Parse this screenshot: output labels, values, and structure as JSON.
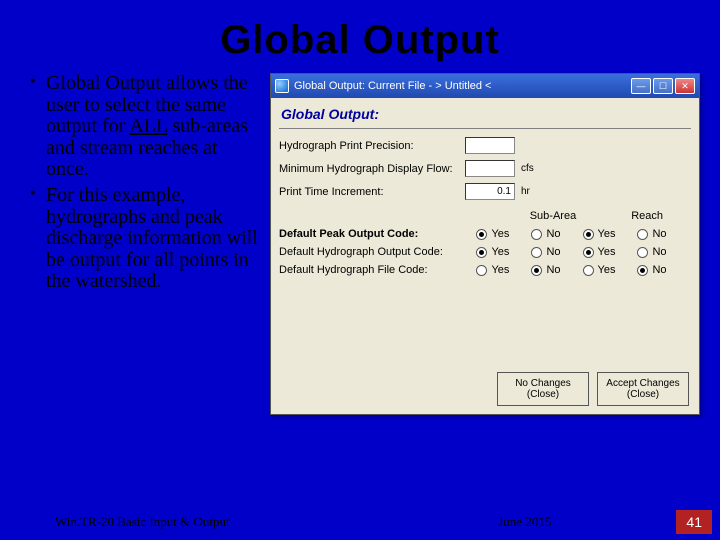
{
  "slide_title": "Global Output",
  "bullets": {
    "b1_pre": "Global Output allows the user to select the same output for ",
    "b1_all": "ALL",
    "b1_post": " sub-areas and stream reaches at once.",
    "b2": "For this example, hydrographs and peak discharge information will be output for all points in the watershed."
  },
  "window": {
    "title": "Global Output: Current File - > Untitled <",
    "section": "Global Output:",
    "rows": {
      "precision_label": "Hydrograph Print Precision:",
      "precision_value": "",
      "minflow_label": "Minimum Hydrograph Display Flow:",
      "minflow_value": "",
      "minflow_unit": "cfs",
      "time_label": "Print Time Increment:",
      "time_value": "0.1",
      "time_unit": "hr"
    },
    "col_sub": "Sub-Area",
    "col_reach": "Reach",
    "opt1": "Default Peak Output Code:",
    "opt2": "Default Hydrograph Output Code:",
    "opt3": "Default Hydrograph File Code:",
    "yes": "Yes",
    "no": "No",
    "btn_no_changes_l1": "No Changes",
    "btn_no_changes_l2": "(Close)",
    "btn_accept_l1": "Accept Changes",
    "btn_accept_l2": "(Close)"
  },
  "footer": {
    "left": "Win.TR-20 Basic Input & Output",
    "date": "June 2015",
    "page": "41"
  }
}
